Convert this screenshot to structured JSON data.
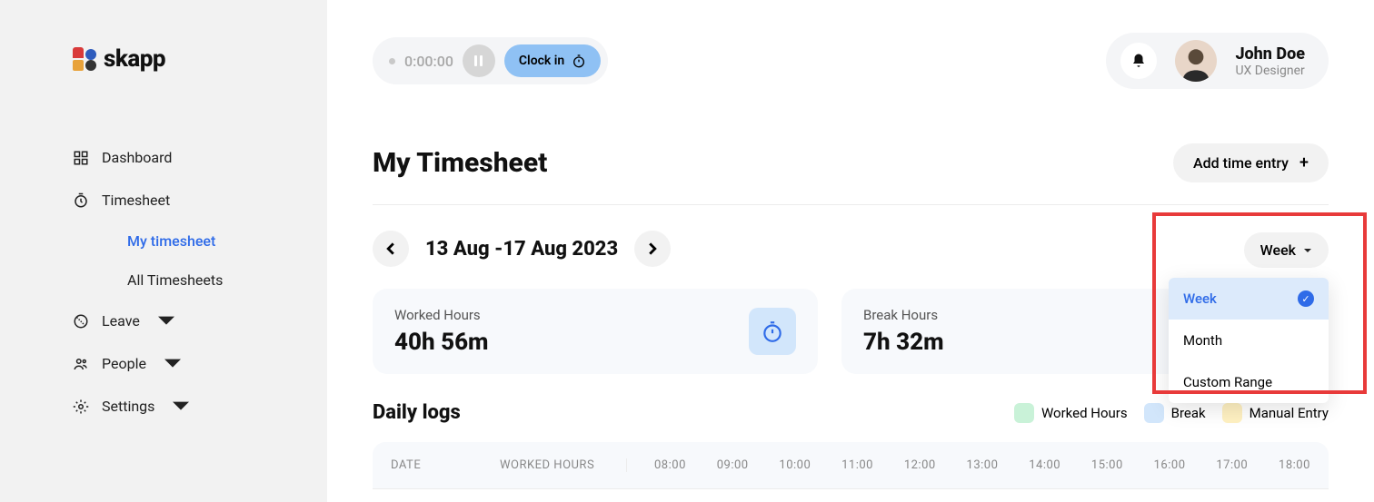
{
  "brand": "skapp",
  "sidebar": {
    "items": [
      {
        "label": "Dashboard"
      },
      {
        "label": "Timesheet"
      },
      {
        "label": "Leave"
      },
      {
        "label": "People"
      },
      {
        "label": "Settings"
      }
    ],
    "timesheet_sub": [
      {
        "label": "My timesheet"
      },
      {
        "label": "All Timesheets"
      }
    ]
  },
  "clock": {
    "time": "0:00:00",
    "clockin_label": "Clock in"
  },
  "user": {
    "name": "John Doe",
    "role": "UX Designer"
  },
  "page": {
    "title": "My Timesheet",
    "add_entry_label": "Add time entry"
  },
  "date_nav": {
    "range": "13 Aug -17 Aug 2023"
  },
  "period": {
    "selected": "Week",
    "options": [
      "Week",
      "Month",
      "Custom Range"
    ]
  },
  "cards": {
    "worked": {
      "label": "Worked Hours",
      "value": "40h 56m"
    },
    "break": {
      "label": "Break Hours",
      "value": "7h 32m"
    }
  },
  "daily": {
    "title": "Daily logs",
    "legend": {
      "worked": "Worked Hours",
      "break": "Break",
      "manual": "Manual Entry"
    },
    "columns": {
      "date": "DATE",
      "worked": "WORKED HOURS"
    },
    "hours": [
      "08:00",
      "09:00",
      "10:00",
      "11:00",
      "12:00",
      "13:00",
      "14:00",
      "15:00",
      "16:00",
      "17:00",
      "18:00"
    ]
  }
}
